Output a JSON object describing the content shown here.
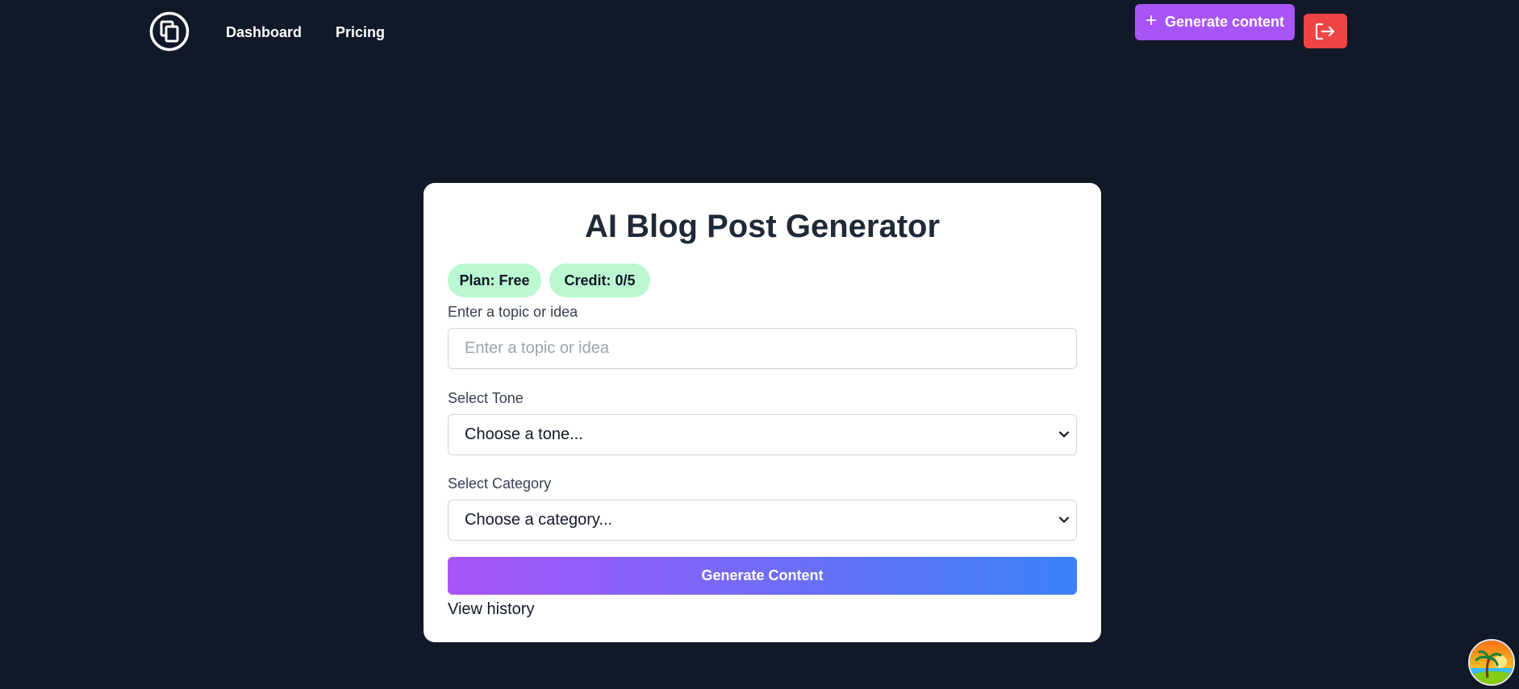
{
  "nav": {
    "logo_icon": "copy-icon",
    "links": [
      "Dashboard",
      "Pricing"
    ],
    "generate_button": "Generate content",
    "logout_icon": "logout-icon"
  },
  "card": {
    "title": "AI Blog Post Generator",
    "plan_badge": "Plan: Free",
    "credit_badge": "Credit: 0/5",
    "topic_label": "Enter a topic or idea",
    "topic_placeholder": "Enter a topic or idea",
    "topic_value": "",
    "tone_label": "Select Tone",
    "tone_selected": "Choose a tone...",
    "category_label": "Select Category",
    "category_selected": "Choose a category...",
    "submit_label": "Generate Content",
    "history_link": "View history"
  },
  "colors": {
    "background": "#111827",
    "accent_purple": "#a855f7",
    "accent_blue": "#3b82f6",
    "logout_red": "#ef4444",
    "badge_green": "#bbf7d0"
  }
}
